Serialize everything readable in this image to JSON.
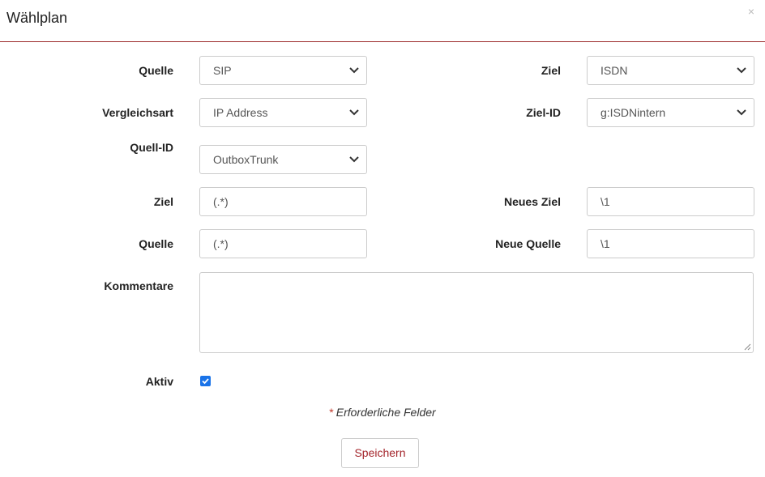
{
  "dialog": {
    "title": "Wählplan",
    "close": "×"
  },
  "form": {
    "quelle": {
      "label": "Quelle",
      "value": "SIP"
    },
    "ziel_select": {
      "label": "Ziel",
      "value": "ISDN"
    },
    "vergleichsart": {
      "label": "Vergleichsart",
      "value": "IP Address"
    },
    "ziel_id": {
      "label": "Ziel-ID",
      "value": "g:ISDNintern"
    },
    "quell_id": {
      "label": "Quell-ID",
      "value": "OutboxTrunk"
    },
    "ziel_input": {
      "label": "Ziel",
      "value": "(.*)"
    },
    "neues_ziel": {
      "label": "Neues Ziel",
      "value": "\\1"
    },
    "quelle_input": {
      "label": "Quelle",
      "value": "(.*)"
    },
    "neue_quelle": {
      "label": "Neue Quelle",
      "value": "\\1"
    },
    "kommentare": {
      "label": "Kommentare",
      "value": ""
    },
    "aktiv": {
      "label": "Aktiv",
      "checked": true
    }
  },
  "footer": {
    "required_star": "*",
    "required_text": "Erforderliche Felder",
    "save_label": "Speichern"
  }
}
